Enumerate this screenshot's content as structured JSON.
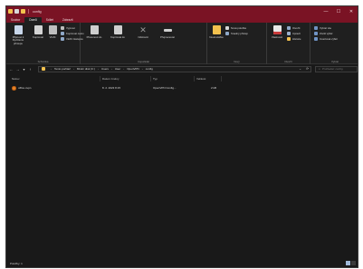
{
  "titlebar": {
    "title": "config"
  },
  "window_controls": {
    "minimize": "—",
    "maximize": "☐",
    "close": "✕"
  },
  "tabs": [
    {
      "label": "Soubor",
      "active": false
    },
    {
      "label": "Domů",
      "active": true
    },
    {
      "label": "Sdílet",
      "active": false
    },
    {
      "label": "Zobrazit",
      "active": false
    }
  ],
  "ribbon": {
    "clipboard": {
      "label": "Schránka",
      "pin": "Připnout k Rychlému přístupu",
      "copy": "Kopírovat",
      "paste": "Vložit",
      "cut": "Vyjmout",
      "copy_path": "Kopírovat cestu",
      "paste_shortcut": "Vložit zástupce"
    },
    "organize": {
      "label": "Uspořádat",
      "move_to": "Přesunout do",
      "copy_to": "Kopírovat do",
      "delete": "Odstranit",
      "rename": "Přejmenovat"
    },
    "new": {
      "label": "Nový",
      "new_folder": "Nová složka",
      "new_item": "Nová položka",
      "easy_access": "Snadný přístup"
    },
    "open": {
      "label": "Otevřít",
      "properties": "Vlastnosti",
      "open": "Otevřít",
      "edit": "Upravit",
      "history": "Historie"
    },
    "select": {
      "label": "Vybrat",
      "select_all": "Vybrat vše",
      "select_none": "Zrušit výběr",
      "invert": "Invertovat výběr"
    }
  },
  "navbar": {
    "back": "←",
    "forward": "→",
    "up": "↑",
    "breadcrumbs": [
      "Tento počítač",
      "Místní disk (C:)",
      "Users",
      "User",
      "OpenVPN",
      "config"
    ],
    "refresh": "⟳",
    "search_placeholder": "Prohledat: config"
  },
  "columns": {
    "name": "Název",
    "date": "Datum změny",
    "type": "Typ",
    "size": "Velikost"
  },
  "files": [
    {
      "name": "office.ovpn",
      "date": "8. 2. 2023 8:15",
      "type": "OpenVPN Config...",
      "size": "2 kB"
    }
  ],
  "status": {
    "items": "Položky: 1"
  },
  "colors": {
    "titlebar": "#7a1324",
    "background": "#191919",
    "accent": "#f2c14e"
  }
}
